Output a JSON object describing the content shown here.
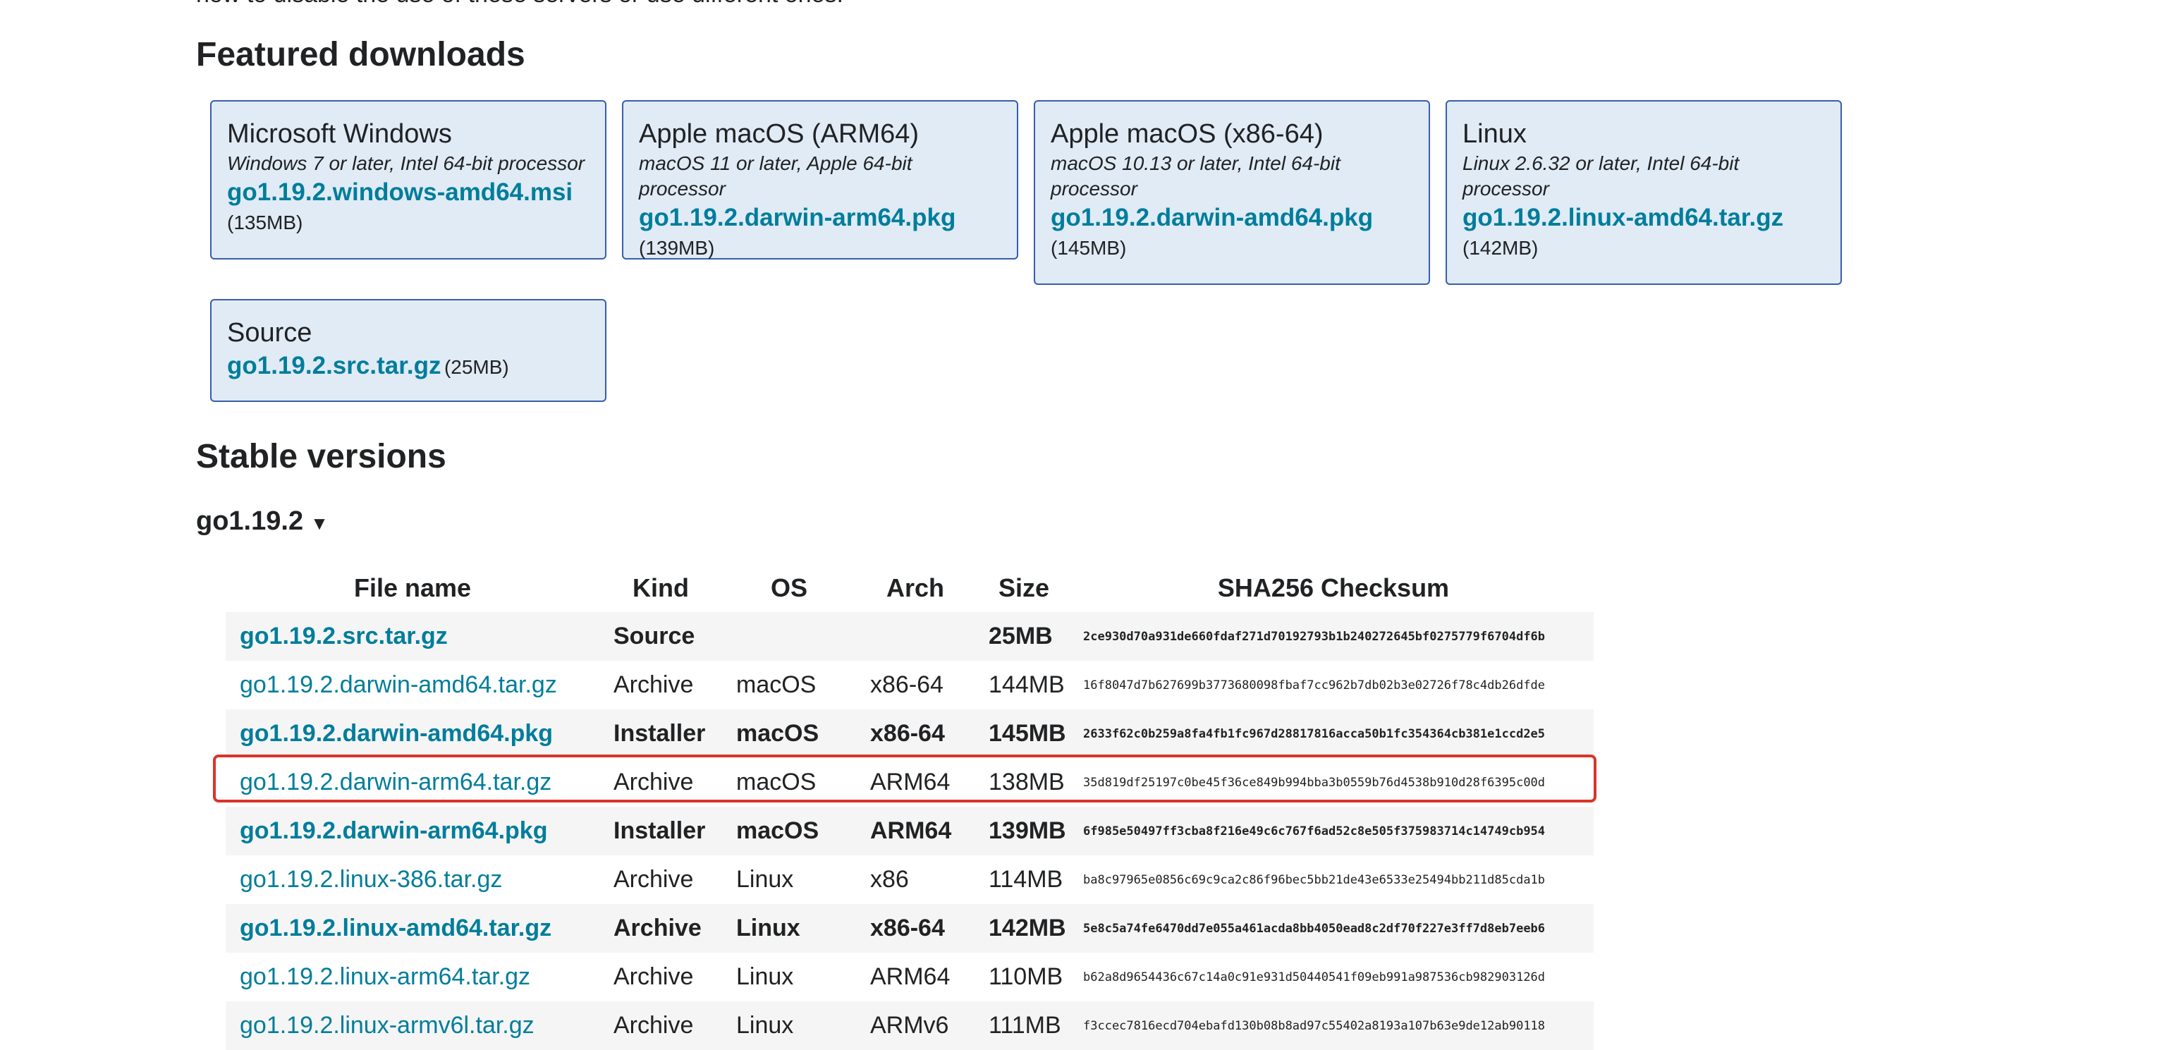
{
  "intro": {
    "text": "now to disable the use of these servers or use different ones."
  },
  "featured": {
    "heading": "Featured downloads",
    "cards": [
      {
        "title": "Microsoft Windows",
        "platform": "Windows 7 or later, Intel 64-bit processor",
        "file": "go1.19.2.windows-amd64.msi",
        "size": "(135MB)"
      },
      {
        "title": "Apple macOS (ARM64)",
        "platform": "macOS 11 or later, Apple 64-bit processor",
        "file": "go1.19.2.darwin-arm64.pkg",
        "size": "(139MB)"
      },
      {
        "title": "Apple macOS (x86-64)",
        "platform": "macOS 10.13 or later, Intel 64-bit processor",
        "file": "go1.19.2.darwin-amd64.pkg",
        "size": "(145MB)"
      },
      {
        "title": "Linux",
        "platform": "Linux 2.6.32 or later, Intel 64-bit processor",
        "file": "go1.19.2.linux-amd64.tar.gz",
        "size": "(142MB)"
      },
      {
        "title": "Source",
        "file": "go1.19.2.src.tar.gz",
        "size": "(25MB)"
      }
    ]
  },
  "stable": {
    "heading": "Stable versions",
    "version": "go1.19.2",
    "toggle_arrow": "▼",
    "table": {
      "headers": [
        "File name",
        "Kind",
        "OS",
        "Arch",
        "Size",
        "SHA256 Checksum"
      ],
      "rows": [
        {
          "file": "go1.19.2.src.tar.gz",
          "kind": "Source",
          "os": "",
          "arch": "",
          "size": "25MB",
          "checksum": "2ce930d70a931de660fdaf271d70192793b1b240272645bf0275779f6704df6b"
        },
        {
          "file": "go1.19.2.darwin-amd64.tar.gz",
          "kind": "Archive",
          "os": "macOS",
          "arch": "x86-64",
          "size": "144MB",
          "checksum": "16f8047d7b627699b3773680098fbaf7cc962b7db02b3e02726f78c4db26dfde"
        },
        {
          "file": "go1.19.2.darwin-amd64.pkg",
          "kind": "Installer",
          "os": "macOS",
          "arch": "x86-64",
          "size": "145MB",
          "checksum": "2633f62c0b259a8fa4fb1fc967d28817816acca50b1fc354364cb381e1ccd2e5"
        },
        {
          "file": "go1.19.2.darwin-arm64.tar.gz",
          "kind": "Archive",
          "os": "macOS",
          "arch": "ARM64",
          "size": "138MB",
          "checksum": "35d819df25197c0be45f36ce849b994bba3b0559b76d4538b910d28f6395c00d"
        },
        {
          "file": "go1.19.2.darwin-arm64.pkg",
          "kind": "Installer",
          "os": "macOS",
          "arch": "ARM64",
          "size": "139MB",
          "checksum": "6f985e50497ff3cba8f216e49c6c767f6ad52c8e505f375983714c14749cb954"
        },
        {
          "file": "go1.19.2.linux-386.tar.gz",
          "kind": "Archive",
          "os": "Linux",
          "arch": "x86",
          "size": "114MB",
          "checksum": "ba8c97965e0856c69c9ca2c86f96bec5bb21de43e6533e25494bb211d85cda1b"
        },
        {
          "file": "go1.19.2.linux-amd64.tar.gz",
          "kind": "Archive",
          "os": "Linux",
          "arch": "x86-64",
          "size": "142MB",
          "checksum": "5e8c5a74fe6470dd7e055a461acda8bb4050ead8c2df70f227e3ff7d8eb7eeb6"
        },
        {
          "file": "go1.19.2.linux-arm64.tar.gz",
          "kind": "Archive",
          "os": "Linux",
          "arch": "ARM64",
          "size": "110MB",
          "checksum": "b62a8d9654436c67c14a0c91e931d50440541f09eb991a987536cb982903126d"
        },
        {
          "file": "go1.19.2.linux-armv6l.tar.gz",
          "kind": "Archive",
          "os": "Linux",
          "arch": "ARMv6",
          "size": "111MB",
          "checksum": "f3ccec7816ecd704ebafd130b08b8ad97c55402a8193a107b63e9de12ab90118"
        }
      ]
    }
  },
  "colors": {
    "link": "#007d9c",
    "card_background": "#e0ebf5",
    "card_border": "#375eab",
    "row_stripe": "#f5f5f5",
    "selection_outline": "#d9352a"
  }
}
